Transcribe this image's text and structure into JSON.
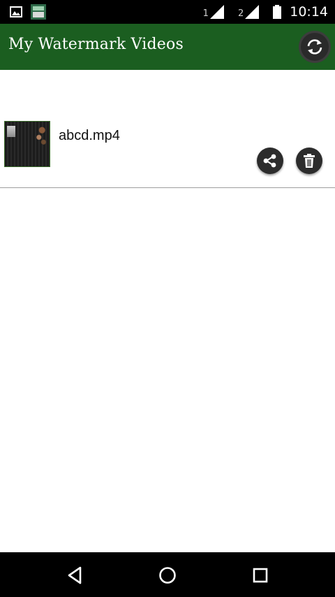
{
  "status_bar": {
    "sim1_label": "1",
    "sim2_label": "2",
    "time": "10:14",
    "icons": [
      "image-notification-icon",
      "app-notification-icon",
      "signal-icon",
      "battery-icon"
    ]
  },
  "app_bar": {
    "title": "My Watermark Videos",
    "refresh_icon": "refresh-icon",
    "color": "#1b5e20"
  },
  "videos": [
    {
      "filename": "abcd.mp4",
      "actions": [
        "share-icon",
        "trash-icon"
      ]
    }
  ],
  "nav_bar": {
    "icons": [
      "back-icon",
      "home-icon",
      "recent-apps-icon"
    ]
  }
}
